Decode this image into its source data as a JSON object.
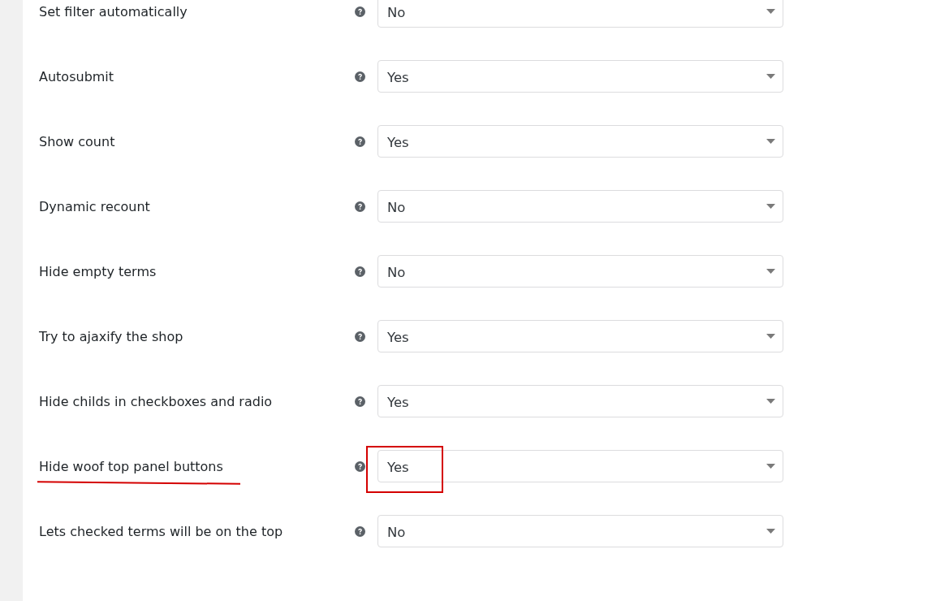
{
  "settings": [
    {
      "label": "Set filter automatically",
      "value": "No",
      "highlighted": false
    },
    {
      "label": "Autosubmit",
      "value": "Yes",
      "highlighted": false
    },
    {
      "label": "Show count",
      "value": "Yes",
      "highlighted": false
    },
    {
      "label": "Dynamic recount",
      "value": "No",
      "highlighted": false
    },
    {
      "label": "Hide empty terms",
      "value": "No",
      "highlighted": false
    },
    {
      "label": "Try to ajaxify the shop",
      "value": "Yes",
      "highlighted": false
    },
    {
      "label": "Hide childs in checkboxes and radio",
      "value": "Yes",
      "highlighted": false
    },
    {
      "label": "Hide woof top panel buttons",
      "value": "Yes",
      "highlighted": true
    },
    {
      "label": "Lets checked terms will be on the top",
      "value": "No",
      "highlighted": false
    }
  ]
}
